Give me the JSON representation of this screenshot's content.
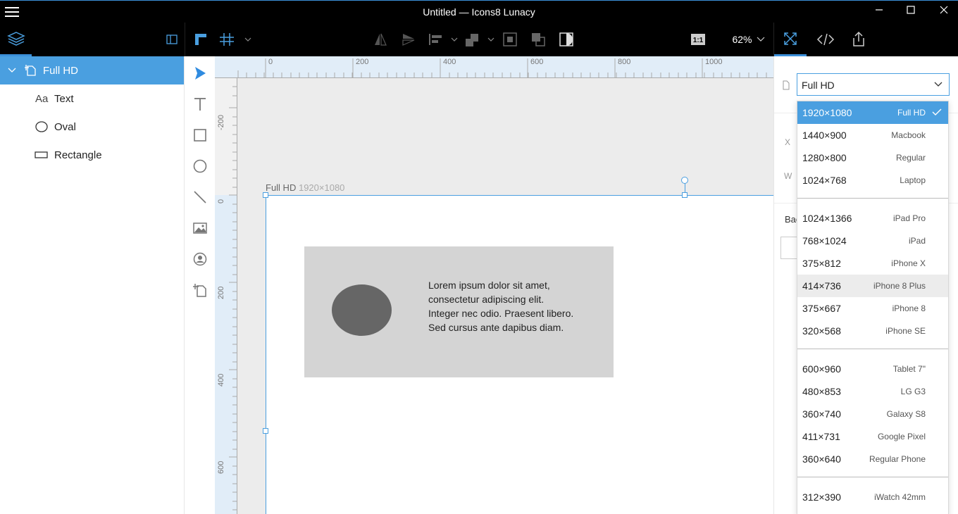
{
  "window": {
    "title": "Untitled — Icons8 Lunacy"
  },
  "toolbar": {
    "zoom": "62%",
    "one_to_one": "1:1"
  },
  "layers": [
    {
      "name": "Full HD",
      "icon": "artboard-icon",
      "selected": true
    },
    {
      "name": "Text",
      "icon": "text-layer-icon",
      "glyph": "Aa"
    },
    {
      "name": "Oval",
      "icon": "oval-layer-icon"
    },
    {
      "name": "Rectangle",
      "icon": "rectangle-layer-icon"
    }
  ],
  "rulers": {
    "horizontal": [
      "0",
      "200",
      "400",
      "600",
      "800",
      "1000"
    ],
    "vertical": [
      "-200",
      "0",
      "200",
      "400",
      "600"
    ]
  },
  "artboard": {
    "name": "Full HD",
    "size": "1920×1080"
  },
  "canvas_text": {
    "lines": [
      "Lorem ipsum dolor sit amet,",
      "consectetur adipiscing elit.",
      "Integer nec odio. Praesent libero.",
      "Sed cursus ante dapibus diam."
    ]
  },
  "inspector": {
    "preset_value": "Full HD",
    "labels": {
      "x": "X",
      "w": "W",
      "background": "Bac"
    }
  },
  "presets": [
    {
      "res": "1920×1080",
      "name": "Full HD",
      "selected": true
    },
    {
      "res": "1440×900",
      "name": "Macbook"
    },
    {
      "res": "1280×800",
      "name": "Regular"
    },
    {
      "res": "1024×768",
      "name": "Laptop"
    },
    {
      "res": "1024×1366",
      "name": "iPad Pro"
    },
    {
      "res": "768×1024",
      "name": "iPad"
    },
    {
      "res": "375×812",
      "name": "iPhone X"
    },
    {
      "res": "414×736",
      "name": "iPhone 8 Plus",
      "hover": true
    },
    {
      "res": "375×667",
      "name": "iPhone 8"
    },
    {
      "res": "320×568",
      "name": "iPhone SE"
    },
    {
      "res": "600×960",
      "name": "Tablet 7\""
    },
    {
      "res": "480×853",
      "name": "LG G3"
    },
    {
      "res": "360×740",
      "name": "Galaxy S8"
    },
    {
      "res": "411×731",
      "name": "Google Pixel"
    },
    {
      "res": "360×640",
      "name": "Regular Phone"
    },
    {
      "res": "312×390",
      "name": "iWatch 42mm"
    }
  ],
  "colors": {
    "accent": "#4a9fe0",
    "toolbar_bg": "#000000",
    "canvas_bg": "#ececec",
    "shape_rect": "#d4d4d4",
    "shape_oval": "#666666"
  }
}
